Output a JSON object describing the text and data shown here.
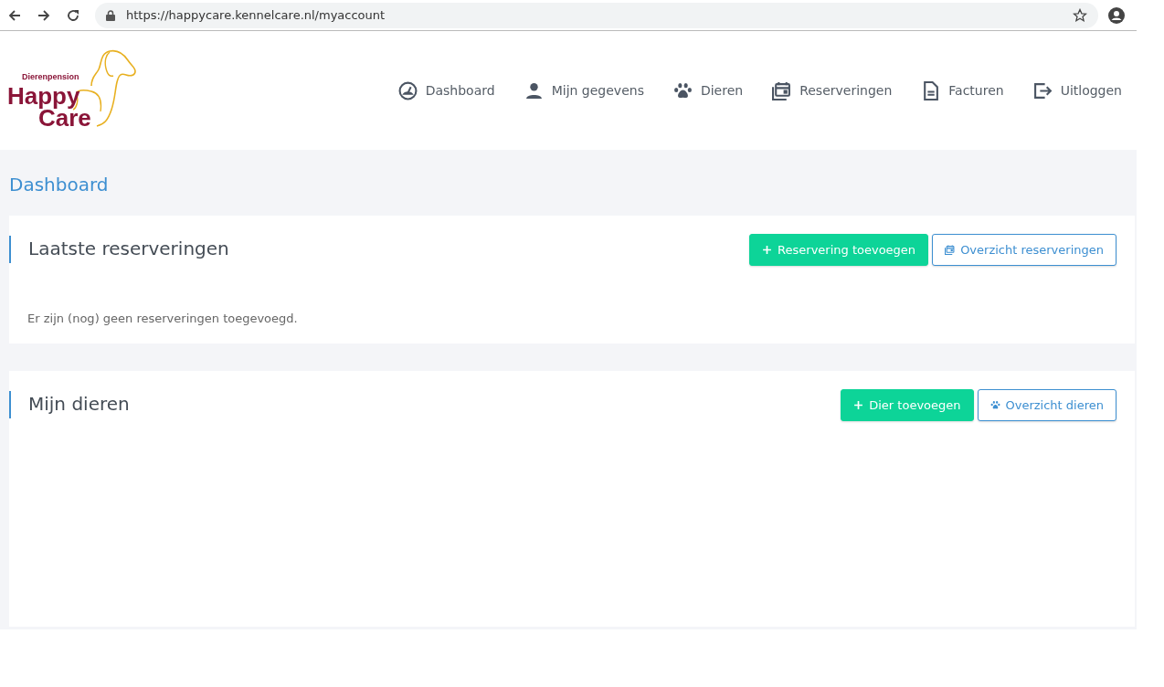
{
  "browser": {
    "url": "https://happycare.kennelcare.nl/myaccount"
  },
  "logo": {
    "tagline": "Dierenpension",
    "line_1": "Happy",
    "line_2": "Care"
  },
  "nav": [
    {
      "label": "Dashboard",
      "kind": "gauge"
    },
    {
      "label": "Mijn gegevens",
      "kind": "person"
    },
    {
      "label": "Dieren",
      "kind": "paw"
    },
    {
      "label": "Reserveringen",
      "kind": "calendar"
    },
    {
      "label": "Facturen",
      "kind": "document"
    },
    {
      "label": "Uitloggen",
      "kind": "exit"
    }
  ],
  "page_title": "Dashboard",
  "sections": [
    {
      "title": "Laatste reserveringen",
      "kind": "reservations",
      "buttons": [
        {
          "label": "Reservering toevoegen",
          "kind": "primary"
        },
        {
          "label": "Overzicht reserveringen",
          "kind": "outline"
        }
      ],
      "message": "Er zijn (nog) geen reserveringen toegevoegd."
    },
    {
      "title": "Mijn dieren",
      "kind": "animals",
      "buttons": [
        {
          "label": "Dier toevoegen",
          "kind": "primary"
        },
        {
          "label": "Overzicht dieren",
          "kind": "outline"
        }
      ]
    }
  ]
}
